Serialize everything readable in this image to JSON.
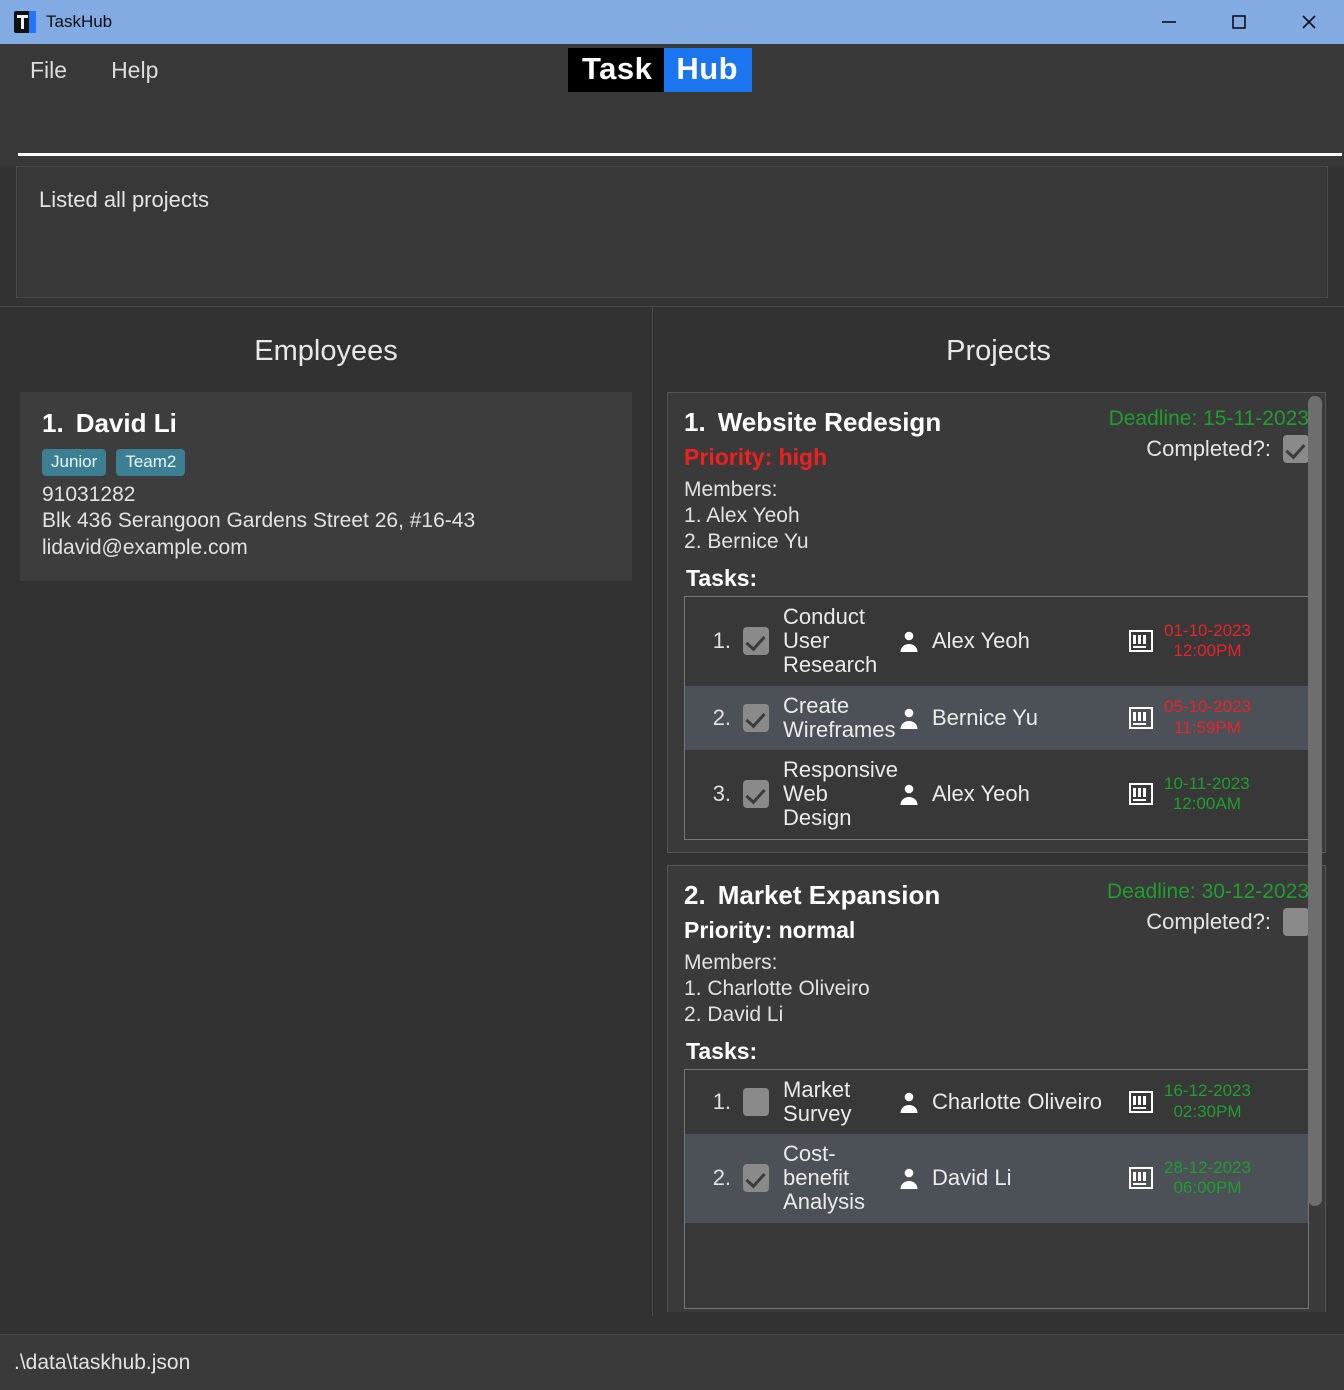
{
  "window": {
    "title": "TaskHub",
    "app_icon": "taskhub-logo-icon",
    "minimize_icon": "minimize-icon",
    "maximize_icon": "maximize-icon",
    "close_icon": "close-icon"
  },
  "menubar": {
    "items": [
      {
        "label": "File"
      },
      {
        "label": "Help"
      }
    ]
  },
  "logo": {
    "part_a": "Task",
    "part_b": "Hub"
  },
  "command": {
    "value": "",
    "placeholder": ""
  },
  "result": {
    "text": "Listed all projects"
  },
  "employees_panel": {
    "title": "Employees",
    "items": [
      {
        "index": "1.",
        "name": "David Li",
        "tags": [
          "Junior",
          "Team2"
        ],
        "phone": "91031282",
        "address": "Blk 436 Serangoon Gardens Street 26, #16-43",
        "email": "lidavid@example.com"
      }
    ]
  },
  "projects_panel": {
    "title": "Projects",
    "deadline_prefix": "Deadline: ",
    "completed_label": "Completed?:",
    "members_label": "Members:",
    "tasks_label": "Tasks:",
    "priority_prefix": "Priority: ",
    "items": [
      {
        "index": "1.",
        "name": "Website Redesign",
        "priority_text": "Priority: high",
        "priority_color": "#f02020",
        "deadline": "Deadline: 15-11-2023",
        "deadline_color": "#1f9e2e",
        "completed": true,
        "members": [
          "1. Alex Yeoh",
          "2. Bernice Yu"
        ],
        "tasks": [
          {
            "num": "1.",
            "done": true,
            "name": "Conduct User Research",
            "owner": "Alex Yeoh",
            "date": "01-10-2023",
            "time": "12:00PM",
            "date_color": "#e8232a"
          },
          {
            "num": "2.",
            "done": true,
            "name": "Create Wireframes",
            "owner": "Bernice Yu",
            "date": "05-10-2023",
            "time": "11:59PM",
            "date_color": "#e8232a"
          },
          {
            "num": "3.",
            "done": true,
            "name": "Responsive Web Design",
            "owner": "Alex Yeoh",
            "date": "10-11-2023",
            "time": "12:00AM",
            "date_color": "#1f9e2e"
          }
        ]
      },
      {
        "index": "2.",
        "name": "Market Expansion",
        "priority_text": "Priority: normal",
        "priority_color": "#ffffff",
        "deadline": "Deadline: 30-12-2023",
        "deadline_color": "#1f9e2e",
        "completed": false,
        "members": [
          "1. Charlotte Oliveiro",
          "2. David Li"
        ],
        "tasks": [
          {
            "num": "1.",
            "done": false,
            "name": "Market Survey",
            "owner": "Charlotte Oliveiro",
            "date": "16-12-2023",
            "time": "02:30PM",
            "date_color": "#1f9e2e"
          },
          {
            "num": "2.",
            "done": true,
            "name": "Cost-benefit Analysis",
            "owner": "David Li",
            "date": "28-12-2023",
            "time": "06:00PM",
            "date_color": "#1f9e2e"
          }
        ]
      }
    ]
  },
  "statusbar": {
    "path": ".\\data\\taskhub.json"
  }
}
